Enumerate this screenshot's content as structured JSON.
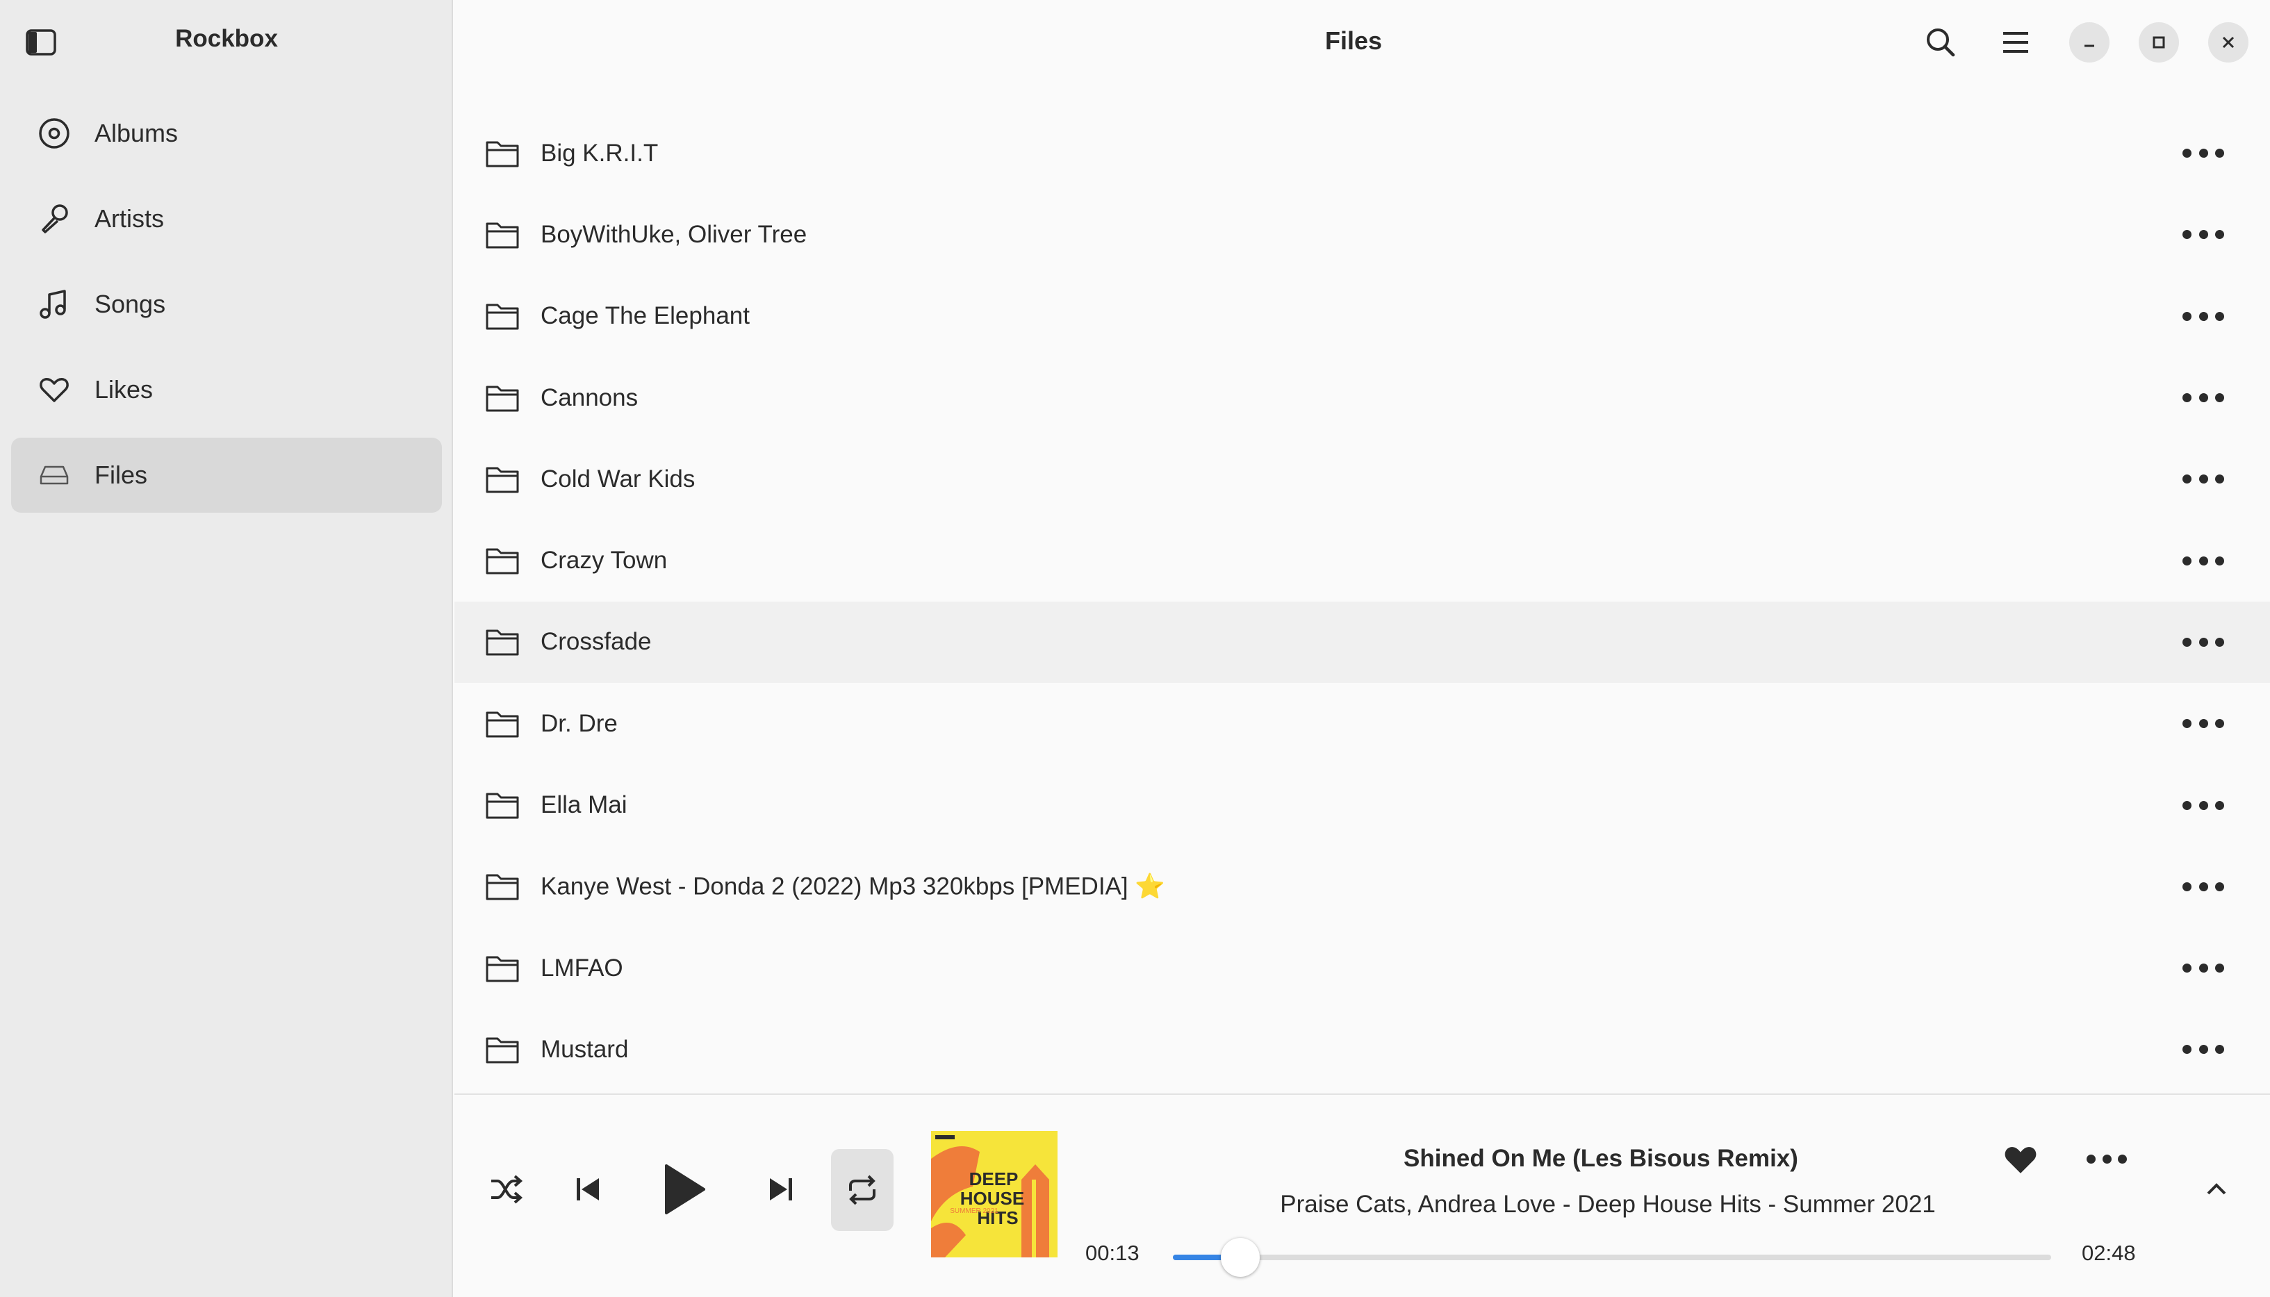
{
  "sidebar": {
    "title": "Rockbox",
    "toggle_icon": "sidebar-toggle-icon",
    "items": [
      {
        "label": "Albums",
        "icon": "disc-icon",
        "active": false
      },
      {
        "label": "Artists",
        "icon": "microphone-icon",
        "active": false
      },
      {
        "label": "Songs",
        "icon": "music-note-icon",
        "active": false
      },
      {
        "label": "Likes",
        "icon": "heart-icon",
        "active": false
      },
      {
        "label": "Files",
        "icon": "drive-icon",
        "active": true
      }
    ]
  },
  "header": {
    "title": "Files",
    "search_icon": "search-icon",
    "menu_icon": "hamburger-menu-icon",
    "minimize_icon": "minimize-icon",
    "maximize_icon": "maximize-icon",
    "close_icon": "close-icon"
  },
  "files": [
    {
      "name": "Big K.R.I.T"
    },
    {
      "name": "BoyWithUke, Oliver Tree"
    },
    {
      "name": "Cage The Elephant"
    },
    {
      "name": "Cannons"
    },
    {
      "name": "Cold War Kids"
    },
    {
      "name": "Crazy Town"
    },
    {
      "name": "Crossfade"
    },
    {
      "name": "Dr. Dre"
    },
    {
      "name": "Ella Mai"
    },
    {
      "name": "Kanye West - Donda 2 (2022) Mp3 320kbps [PMEDIA] ⭐️"
    },
    {
      "name": "LMFAO"
    },
    {
      "name": "Mustard"
    }
  ],
  "player": {
    "track_title": "Shined On Me (Les Bisous Remix)",
    "track_subtitle": "Praise Cats, Andrea Love - Deep House Hits - Summer 2021",
    "elapsed": "00:13",
    "duration": "02:48",
    "progress_fraction": 0.077,
    "album_art_text": [
      "DEEP",
      "HOUSE",
      "HITS"
    ],
    "album_art_small_text": "SUMMER 2021",
    "liked": true,
    "accent_color": "#3584e4"
  }
}
